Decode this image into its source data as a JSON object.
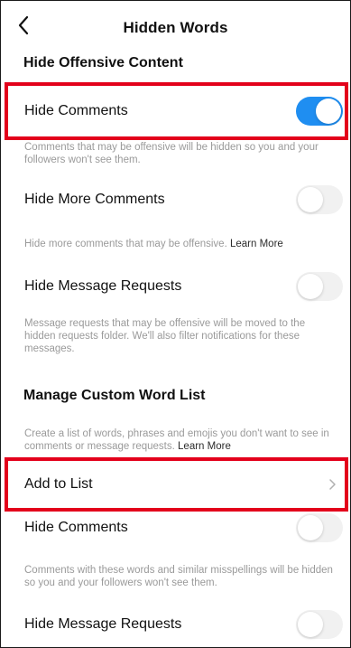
{
  "header": {
    "title": "Hidden Words",
    "back_icon": "chevron-left-icon"
  },
  "sections": {
    "offensive": {
      "title": "Hide Offensive Content",
      "hide_comments": {
        "label": "Hide Comments",
        "enabled": true,
        "description": "Comments that may be offensive will be hidden so you and your followers won't see them."
      },
      "hide_more_comments": {
        "label": "Hide More Comments",
        "enabled": false,
        "description": "Hide more comments that may be offensive.",
        "learn_more": "Learn More"
      },
      "hide_message_requests": {
        "label": "Hide Message Requests",
        "enabled": false,
        "description": "Message requests that may be offensive will be moved to the hidden requests folder. We'll also filter notifications for these messages."
      }
    },
    "custom": {
      "title": "Manage Custom Word List",
      "description": "Create a list of words, phrases and emojis you don't want to see in comments or message requests.",
      "learn_more": "Learn More",
      "add_to_list": {
        "label": "Add to List",
        "icon": "chevron-right-icon"
      },
      "hide_comments": {
        "label": "Hide Comments",
        "enabled": false,
        "description": "Comments with these words and similar misspellings will be hidden so you and your followers won't see them."
      },
      "hide_message_requests": {
        "label": "Hide Message Requests",
        "enabled": false
      }
    }
  },
  "colors": {
    "toggle_on": "#1f8ef1",
    "toggle_off": "#f1f1f1",
    "highlight": "#e3001b",
    "description_text": "#9a9a9a"
  }
}
